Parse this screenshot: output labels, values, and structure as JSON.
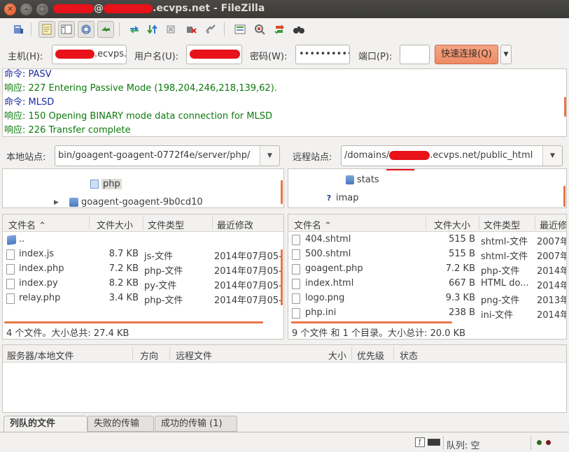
{
  "window": {
    "title_user_suffix": "@",
    "title_host_suffix": ".ecvps.net - FileZilla",
    "close_glyph": "✕",
    "minimize_glyph": "–",
    "maximize_glyph": "□"
  },
  "toolbar": {
    "icons": [
      "site-manager-icon",
      "toggle-message-log-icon",
      "toggle-local-tree-icon",
      "toggle-remote-tree-icon",
      "toggle-transfer-queue-icon",
      "refresh-icon",
      "process-queue-icon",
      "cancel-operation-icon",
      "disconnect-icon",
      "reconnect-icon",
      "directory-listing-filters-icon",
      "toggle-directory-comparison-icon",
      "synchronized-browsing-icon",
      "search-remote-files-icon"
    ]
  },
  "quickconnect": {
    "host_label": "主机(H):",
    "host_value_suffix": ".ecvps.",
    "user_label": "用户名(U):",
    "password_label": "密码(W):",
    "password_value": "••••••••••",
    "port_label": "端口(P):",
    "port_value": "",
    "connect_button": "快速连接(Q)",
    "dropdown_glyph": "▼"
  },
  "log": [
    {
      "kind": "cmd",
      "label": "命令:",
      "text": "PASV"
    },
    {
      "kind": "rsp",
      "label": "响应:",
      "text": "227 Entering Passive Mode (198,204,246,218,139,62)."
    },
    {
      "kind": "cmd",
      "label": "命令:",
      "text": "MLSD"
    },
    {
      "kind": "rsp",
      "label": "响应:",
      "text": "150 Opening BINARY mode data connection for MLSD"
    },
    {
      "kind": "rsp",
      "label": "响应:",
      "text": "226 Transfer complete"
    }
  ],
  "local": {
    "site_label": "本地站点:",
    "path": "bin/goagent-goagent-0772f4e/server/php/",
    "tree": [
      {
        "name": "php",
        "selected": true
      },
      {
        "name": "goagent-goagent-9b0cd10",
        "expander": "▶"
      }
    ],
    "columns": [
      "文件名",
      "文件大小",
      "文件类型",
      "最近修改"
    ],
    "sort_glyph": "⌃",
    "parent_dir": "..",
    "files": [
      {
        "name": "index.js",
        "size": "8.7 KB",
        "type": "js-文件",
        "modified": "2014年07月05-"
      },
      {
        "name": "index.php",
        "size": "7.2 KB",
        "type": "php-文件",
        "modified": "2014年07月05-"
      },
      {
        "name": "index.py",
        "size": "8.2 KB",
        "type": "py-文件",
        "modified": "2014年07月05-"
      },
      {
        "name": "relay.php",
        "size": "3.4 KB",
        "type": "php-文件",
        "modified": "2014年07月05-"
      }
    ],
    "status": "4 个文件。大小总共: 27.4 KB"
  },
  "remote": {
    "site_label": "远程站点:",
    "path_prefix": "/domains/",
    "path_suffix": ".ecvps.net/public_html",
    "tree": [
      {
        "name": "stats",
        "icon": "folder"
      },
      {
        "name": "imap",
        "icon": "unknown"
      }
    ],
    "unknown_glyph": "?",
    "columns": [
      "文件名",
      "文件大小",
      "文件类型",
      "最近修"
    ],
    "sort_glyph": "⌃",
    "files": [
      {
        "name": "404.shtml",
        "size": "515 B",
        "type": "shtml-文件",
        "modified": "2007年"
      },
      {
        "name": "500.shtml",
        "size": "515 B",
        "type": "shtml-文件",
        "modified": "2007年"
      },
      {
        "name": "goagent.php",
        "size": "7.2 KB",
        "type": "php-文件",
        "modified": "2014年"
      },
      {
        "name": "index.html",
        "size": "667 B",
        "type": "HTML do...",
        "modified": "2014年"
      },
      {
        "name": "logo.png",
        "size": "9.3 KB",
        "type": "png-文件",
        "modified": "2013年"
      },
      {
        "name": "php.ini",
        "size": "238 B",
        "type": "ini-文件",
        "modified": "2014年"
      }
    ],
    "status": "9 个文件 和 1 个目录。大小总计: 20.0 KB"
  },
  "queue": {
    "columns": [
      "服务器/本地文件",
      "方向",
      "远程文件",
      "大小",
      "优先级",
      "状态"
    ],
    "tabs": [
      {
        "label": "列队的文件",
        "active": true
      },
      {
        "label": "失败的传输",
        "active": false
      },
      {
        "label": "成功的传输 (1)",
        "active": false
      }
    ]
  },
  "statusbar": {
    "queue_text": "队列: 空",
    "led_colors": [
      "#2f6b1f",
      "#7a1a1a"
    ]
  }
}
